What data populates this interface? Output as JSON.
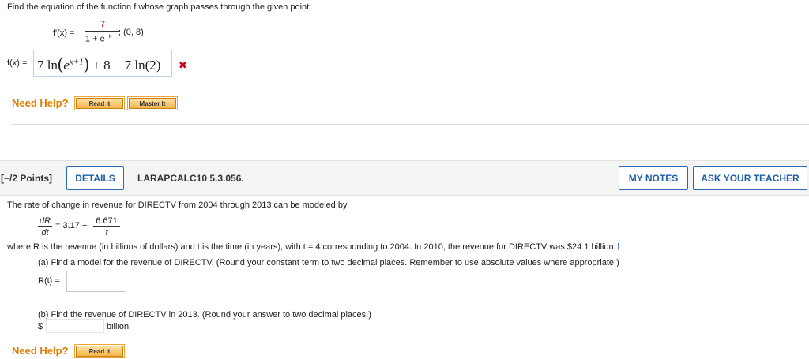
{
  "q1": {
    "prompt": "Find the equation of the function f whose graph passes through the given point.",
    "derivative_lhs": "f'(x) =",
    "numerator": "7",
    "denominator": "1 + e",
    "denominator_exp": "−x",
    "point": "; (0, 8)",
    "answer_label": "f(x) =",
    "answer": {
      "p1": "7 ln",
      "e": "e",
      "e_exp": "x+1",
      "p2": "+ 8 − 7 ln(2)"
    },
    "incorrect_mark": "✖"
  },
  "help1": {
    "label": "Need Help?",
    "read": "Read It",
    "master": "Master It"
  },
  "q2": {
    "points": "[−/2 Points]",
    "details": "DETAILS",
    "code": "LARAPCALC10 5.3.056.",
    "my_notes": "MY NOTES",
    "ask_teacher": "ASK YOUR TEACHER",
    "intro": "The rate of change in revenue for DIRECTV from 2004 through 2013 can be modeled by",
    "dR": "dR",
    "dt": "dt",
    "eq_mid": "= 3.17 −",
    "num": "6.671",
    "den": "t",
    "where": "where R is the revenue (in billions of dollars) and t is the time (in years), with t = 4 corresponding to 2004. In 2010, the revenue for DIRECTV was $24.1 billion.",
    "dagger": "†",
    "part_a": "(a) Find a model for the revenue of DIRECTV. (Round your constant term to two decimal places. Remember to use absolute values where appropriate.)",
    "ra_label": "R(t) =",
    "ra_value": "",
    "part_b": "(b) Find the revenue of DIRECTV in 2013. (Round your answer to two decimal places.)",
    "dollar": "$",
    "rb_value": "",
    "billion": "billion"
  },
  "help2": {
    "label": "Need Help?",
    "read": "Read It"
  }
}
